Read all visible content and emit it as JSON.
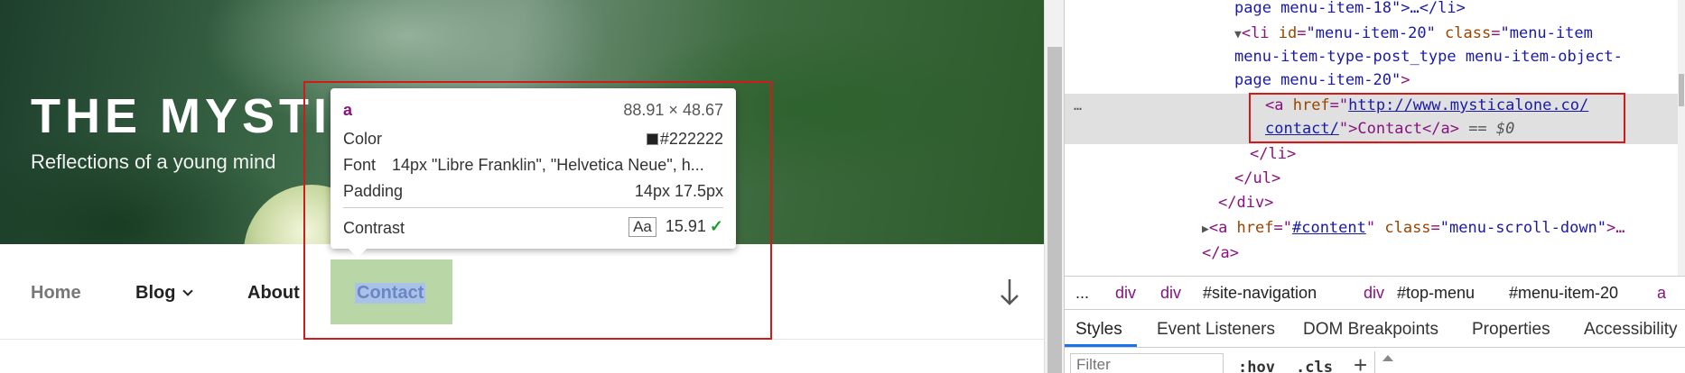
{
  "site": {
    "title": "THE MYSTI",
    "description": "Reflections of a young mind",
    "nav": {
      "home": "Home",
      "blog": "Blog",
      "about": "About",
      "contact": "Contact"
    }
  },
  "tooltip": {
    "tag": "a",
    "dimensions": "88.91 × 48.67",
    "color_label": "Color",
    "color_value": "#222222",
    "font_label": "Font",
    "font_value": "14px \"Libre Franklin\", \"Helvetica Neue\", h...",
    "padding_label": "Padding",
    "padding_value": "14px 17.5px",
    "contrast_label": "Contrast",
    "contrast_aa": "Aa",
    "contrast_value": "15.91",
    "contrast_check": "✓"
  },
  "devtools": {
    "lines": {
      "l1_text": "page menu-item-18\">…</li>",
      "l2_tag": "<li ",
      "l2_attr_id": "id",
      "l2_val_id": "\"menu-item-20\"",
      "l2_attr_class": " class",
      "l2_val_class": "\"menu-item",
      "l3_val": "menu-item-type-post_type menu-item-object-",
      "l4_val": "page menu-item-20\"",
      "l4_close": ">",
      "sel_open": "<a ",
      "sel_attr": "href",
      "sel_eq": "=\"",
      "sel_href1": "http://www.mysticalone.co/",
      "sel_href2": "contact/",
      "sel_rest": "\">Contact</a>",
      "sel_eq0": " == $0",
      "li_close": "</li>",
      "ul_close": "</ul>",
      "div_close": "</div>",
      "a2_open": "<a ",
      "a2_attr_href": "href",
      "a2_val_href": "#content",
      "a2_attr_class": " class",
      "a2_val_class": "\"menu-scroll-down\"",
      "a2_close": ">…",
      "a_close": "</a>",
      "sel_dots": "…"
    },
    "breadcrumbs": [
      "...",
      "div",
      "div",
      "#site-navigation",
      "div",
      "#top-menu",
      "#menu-item-20",
      "a"
    ],
    "tabs": [
      "Styles",
      "Event Listeners",
      "DOM Breakpoints",
      "Properties",
      "Accessibility"
    ],
    "filter_placeholder": "Filter",
    "hov_label": ":hov",
    "cls_label": ".cls",
    "plus_label": "+"
  }
}
